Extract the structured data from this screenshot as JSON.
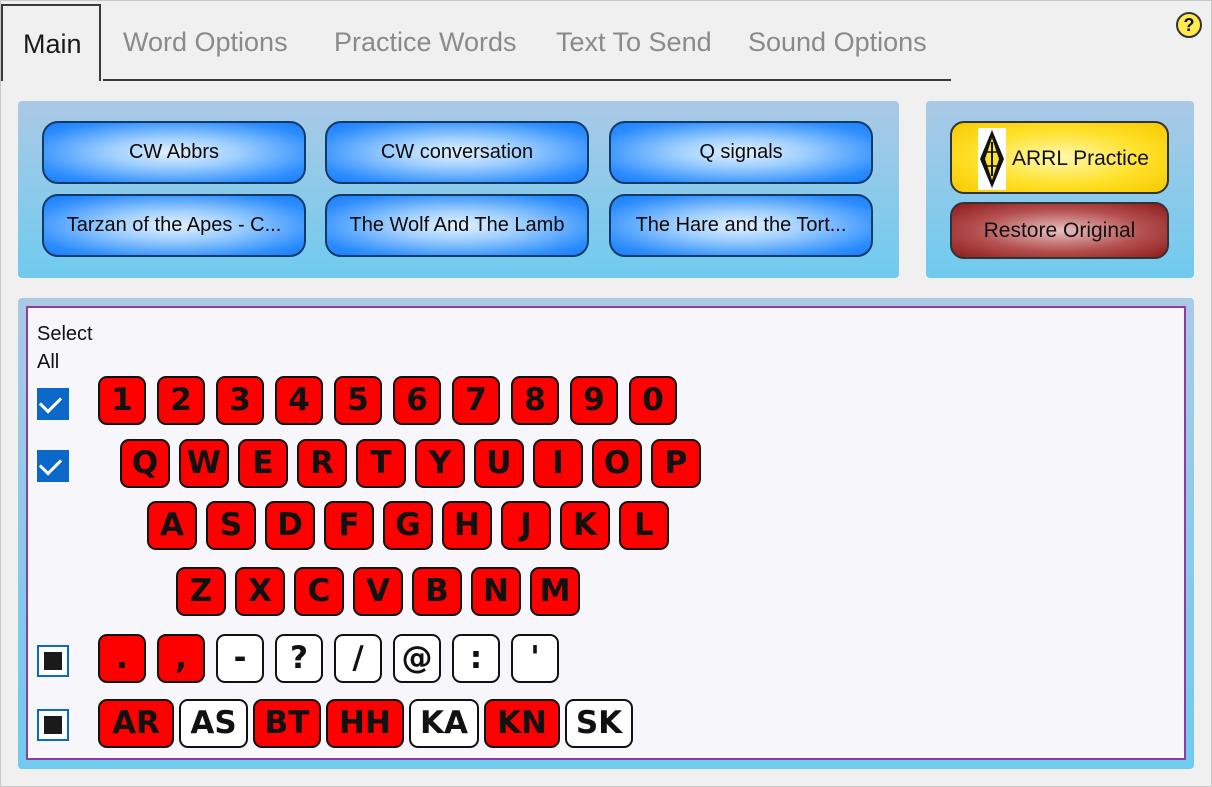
{
  "tabs": [
    {
      "label": "Main",
      "active": true
    },
    {
      "label": "Word Options",
      "active": false
    },
    {
      "label": "Practice Words",
      "active": false
    },
    {
      "label": "Text To Send",
      "active": false
    },
    {
      "label": "Sound Options",
      "active": false
    }
  ],
  "help_label": "?",
  "presets": [
    "CW Abbrs",
    "CW conversation",
    "Q signals",
    "Tarzan of the Apes - C...",
    "The Wolf And The Lamb",
    "The Hare and the Tort..."
  ],
  "actions": {
    "arrl_label": "ARRL Practice",
    "restore_label": "Restore Original"
  },
  "keyboard": {
    "select_all_label": "Select All",
    "row_checks": [
      "checked",
      "checked",
      "partial",
      "partial"
    ],
    "numbers": [
      {
        "k": "1",
        "on": true
      },
      {
        "k": "2",
        "on": true
      },
      {
        "k": "3",
        "on": true
      },
      {
        "k": "4",
        "on": true
      },
      {
        "k": "5",
        "on": true
      },
      {
        "k": "6",
        "on": true
      },
      {
        "k": "7",
        "on": true
      },
      {
        "k": "8",
        "on": true
      },
      {
        "k": "9",
        "on": true
      },
      {
        "k": "0",
        "on": true
      }
    ],
    "row_q": [
      {
        "k": "Q",
        "on": true
      },
      {
        "k": "W",
        "on": true
      },
      {
        "k": "E",
        "on": true
      },
      {
        "k": "R",
        "on": true
      },
      {
        "k": "T",
        "on": true
      },
      {
        "k": "Y",
        "on": true
      },
      {
        "k": "U",
        "on": true
      },
      {
        "k": "I",
        "on": true
      },
      {
        "k": "O",
        "on": true
      },
      {
        "k": "P",
        "on": true
      }
    ],
    "row_a": [
      {
        "k": "A",
        "on": true
      },
      {
        "k": "S",
        "on": true
      },
      {
        "k": "D",
        "on": true
      },
      {
        "k": "F",
        "on": true
      },
      {
        "k": "G",
        "on": true
      },
      {
        "k": "H",
        "on": true
      },
      {
        "k": "J",
        "on": true
      },
      {
        "k": "K",
        "on": true
      },
      {
        "k": "L",
        "on": true
      }
    ],
    "row_z": [
      {
        "k": "Z",
        "on": true
      },
      {
        "k": "X",
        "on": true
      },
      {
        "k": "C",
        "on": true
      },
      {
        "k": "V",
        "on": true
      },
      {
        "k": "B",
        "on": true
      },
      {
        "k": "N",
        "on": true
      },
      {
        "k": "M",
        "on": true
      }
    ],
    "punctuation": [
      {
        "k": ".",
        "on": true
      },
      {
        "k": ",",
        "on": true
      },
      {
        "k": "-",
        "on": false
      },
      {
        "k": "?",
        "on": false
      },
      {
        "k": "/",
        "on": false
      },
      {
        "k": "@",
        "on": false
      },
      {
        "k": ":",
        "on": false
      },
      {
        "k": "'",
        "on": false
      }
    ],
    "prosigns": [
      {
        "k": "AR",
        "on": true
      },
      {
        "k": "AS",
        "on": false
      },
      {
        "k": "BT",
        "on": true
      },
      {
        "k": "HH",
        "on": true
      },
      {
        "k": "KA",
        "on": false
      },
      {
        "k": "KN",
        "on": true
      },
      {
        "k": "SK",
        "on": false
      }
    ]
  },
  "colors": {
    "key_on": "#ff0000",
    "key_off": "#ffffff",
    "preset_blue": "#1a7cff",
    "arrl_yellow": "#ffe12a",
    "restore_red": "#8e1b1b"
  }
}
